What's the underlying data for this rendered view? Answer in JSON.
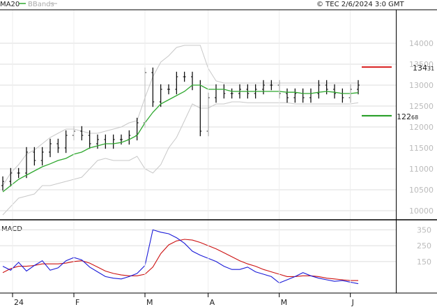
{
  "header": {
    "ma_label": "MA20",
    "bb_label": "BBands",
    "source": "© TEC 2/6/2024 3:0 GMT"
  },
  "colors": {
    "ma": "#2fa82f",
    "bands": "#c8c8c8",
    "price": "#000000",
    "macd": "#1a1ad8",
    "signal": "#cc1111",
    "resistance": "#d81e1e",
    "support": "#1b9a1b"
  },
  "chart_data": [
    {
      "type": "line",
      "name": "price-panel",
      "x": [
        "2024-01-01",
        "2024-01-04",
        "2024-01-08",
        "2024-01-11",
        "2024-01-15",
        "2024-01-18",
        "2024-01-22",
        "2024-01-25",
        "2024-01-29",
        "2024-02-01",
        "2024-02-05",
        "2024-02-08",
        "2024-02-12",
        "2024-02-15",
        "2024-02-19",
        "2024-02-22",
        "2024-02-26",
        "2024-02-29",
        "2024-03-04",
        "2024-03-07",
        "2024-03-11",
        "2024-03-14",
        "2024-03-18",
        "2024-03-21",
        "2024-03-25",
        "2024-03-28",
        "2024-04-01",
        "2024-04-04",
        "2024-04-08",
        "2024-04-11",
        "2024-04-15",
        "2024-04-18",
        "2024-04-22",
        "2024-04-25",
        "2024-04-29",
        "2024-05-02",
        "2024-05-06",
        "2024-05-09",
        "2024-05-13",
        "2024-05-16",
        "2024-05-20",
        "2024-05-23",
        "2024-05-27",
        "2024-05-30",
        "2024-06-03",
        "2024-06-05"
      ],
      "close": [
        1070,
        1090,
        1090,
        1140,
        1120,
        1140,
        1160,
        1150,
        1180,
        1190,
        1180,
        1160,
        1170,
        1160,
        1170,
        1170,
        1180,
        1210,
        1330,
        1260,
        1290,
        1290,
        1320,
        1320,
        1300,
        1190,
        1270,
        1290,
        1280,
        1280,
        1290,
        1280,
        1290,
        1300,
        1300,
        1280,
        1270,
        1280,
        1270,
        1280,
        1300,
        1290,
        1280,
        1270,
        1290,
        1300
      ],
      "ma20": [
        1045,
        1060,
        1075,
        1085,
        1095,
        1105,
        1112,
        1120,
        1125,
        1135,
        1140,
        1150,
        1155,
        1160,
        1160,
        1163,
        1170,
        1180,
        1210,
        1235,
        1255,
        1265,
        1275,
        1285,
        1300,
        1300,
        1290,
        1290,
        1290,
        1285,
        1285,
        1285,
        1285,
        1285,
        1285,
        1285,
        1283,
        1283,
        1280,
        1280,
        1283,
        1285,
        1283,
        1280,
        1280,
        1282
      ],
      "bb_upper": [
        1060,
        1090,
        1110,
        1135,
        1145,
        1160,
        1175,
        1185,
        1195,
        1195,
        1190,
        1185,
        1185,
        1190,
        1195,
        1200,
        1210,
        1215,
        1270,
        1320,
        1355,
        1370,
        1390,
        1395,
        1395,
        1395,
        1340,
        1310,
        1305,
        1305,
        1305,
        1305,
        1305,
        1305,
        1305,
        1305,
        1305,
        1305,
        1305,
        1305,
        1305,
        1305,
        1305,
        1305,
        1305,
        1305
      ],
      "bb_lower": [
        990,
        1010,
        1030,
        1035,
        1040,
        1060,
        1060,
        1065,
        1070,
        1075,
        1080,
        1100,
        1120,
        1125,
        1120,
        1120,
        1120,
        1130,
        1100,
        1090,
        1110,
        1150,
        1175,
        1215,
        1255,
        1245,
        1245,
        1255,
        1255,
        1260,
        1260,
        1258,
        1258,
        1258,
        1258,
        1258,
        1258,
        1255,
        1255,
        1255,
        1255,
        1255,
        1255,
        1255,
        1255,
        1258
      ],
      "y_ticks": [
        "14000",
        "13500",
        "13000",
        "12500",
        "12000",
        "11500",
        "11000",
        "10500",
        "10000"
      ],
      "ylim": [
        950,
        1450
      ],
      "resistance": {
        "value": 1343.1,
        "label_main": "134",
        "label_small": "31"
      },
      "support": {
        "value": 1226.8,
        "label_main": "122",
        "label_small": "68"
      }
    },
    {
      "type": "line",
      "name": "macd-panel",
      "title": "MACD",
      "macd": [
        120,
        95,
        145,
        90,
        125,
        155,
        95,
        110,
        155,
        175,
        160,
        115,
        85,
        55,
        45,
        40,
        55,
        75,
        125,
        350,
        335,
        325,
        300,
        265,
        215,
        190,
        170,
        150,
        120,
        100,
        100,
        115,
        85,
        70,
        55,
        15,
        35,
        55,
        80,
        60,
        45,
        35,
        25,
        30,
        20,
        10
      ],
      "signal": [
        80,
        105,
        120,
        120,
        125,
        135,
        135,
        135,
        140,
        150,
        155,
        140,
        115,
        90,
        75,
        65,
        60,
        60,
        70,
        115,
        200,
        255,
        280,
        290,
        285,
        270,
        250,
        230,
        205,
        180,
        155,
        135,
        120,
        100,
        85,
        70,
        55,
        55,
        60,
        60,
        55,
        45,
        40,
        35,
        30,
        30
      ],
      "y_ticks": [
        "350",
        "250",
        "150"
      ],
      "ylim": [
        -40,
        400
      ]
    }
  ],
  "x_ticks": [
    {
      "label": "24",
      "index": 0
    },
    {
      "label": "F",
      "index": 9
    },
    {
      "label": "M",
      "index": 18
    },
    {
      "label": "A",
      "index": 26
    },
    {
      "label": "M",
      "index": 35
    },
    {
      "label": "J",
      "index": 44
    }
  ]
}
